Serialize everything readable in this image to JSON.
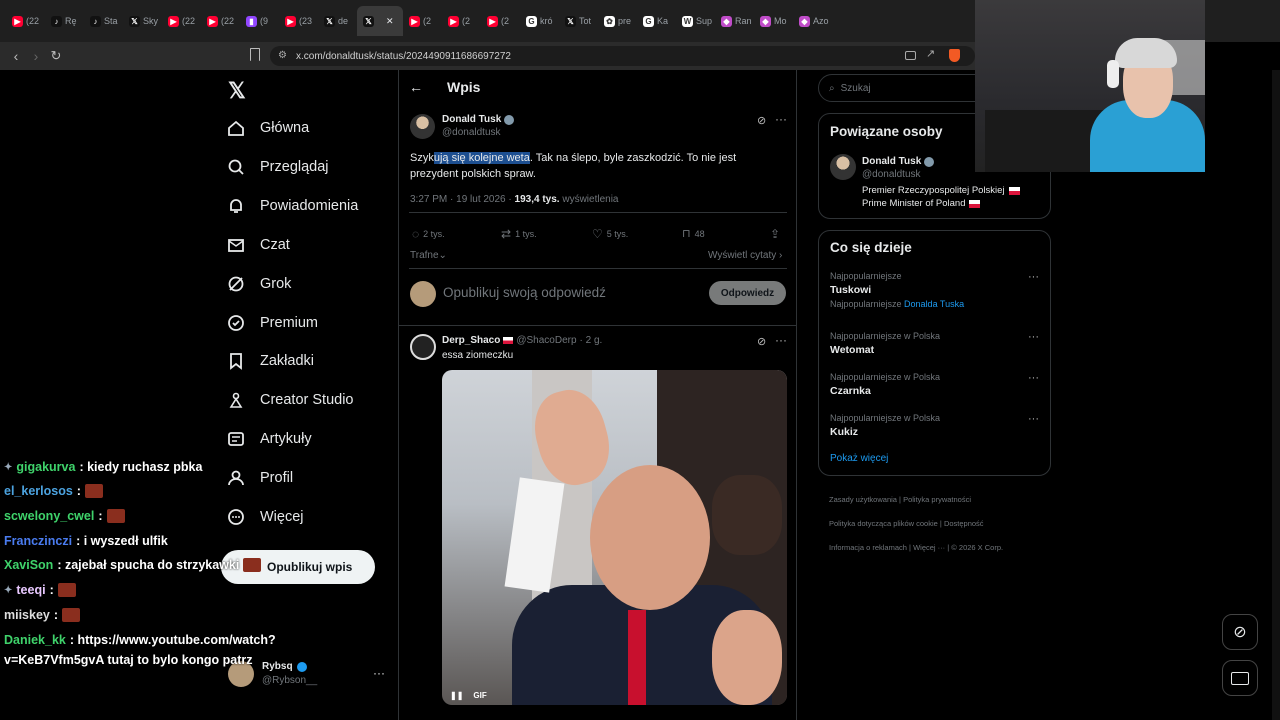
{
  "browser": {
    "tabs": [
      {
        "icon": "youtube-icon",
        "label": "(22"
      },
      {
        "icon": "tiktok-icon",
        "label": "Rę"
      },
      {
        "icon": "tiktok-icon",
        "label": "Sta"
      },
      {
        "icon": "x-icon",
        "label": "Sky"
      },
      {
        "icon": "youtube-icon",
        "label": "(22"
      },
      {
        "icon": "youtube-icon",
        "label": "(22"
      },
      {
        "icon": "twitch-icon",
        "label": "(9"
      },
      {
        "icon": "youtube-icon",
        "label": "(23"
      },
      {
        "icon": "x-icon",
        "label": "de"
      },
      {
        "icon": "x-icon",
        "label": ""
      },
      {
        "icon": "youtube-icon",
        "label": "(2"
      },
      {
        "icon": "youtube-icon",
        "label": "(2"
      },
      {
        "icon": "youtube-icon",
        "label": "(2"
      },
      {
        "icon": "google-icon",
        "label": "kró"
      },
      {
        "icon": "x-icon",
        "label": "Tot"
      },
      {
        "icon": "chatgpt-icon",
        "label": "pre"
      },
      {
        "icon": "google-icon",
        "label": "Ka"
      },
      {
        "icon": "wikipedia-icon",
        "label": "Sup"
      },
      {
        "icon": "app-icon",
        "label": "Ran"
      },
      {
        "icon": "app-icon",
        "label": "Mo"
      },
      {
        "icon": "app-icon",
        "label": "Azo"
      }
    ],
    "url": "x.com/donaldtusk/status/2024490911686697272",
    "colors": {
      "youtube": "#ff0033",
      "accent": "#1d9bf0"
    }
  },
  "nav": {
    "items": [
      {
        "label": "Główna",
        "icon": "home-icon"
      },
      {
        "label": "Przeglądaj",
        "icon": "search-icon"
      },
      {
        "label": "Powiadomienia",
        "icon": "bell-icon"
      },
      {
        "label": "Czat",
        "icon": "mail-icon"
      },
      {
        "label": "Grok",
        "icon": "grok-icon"
      },
      {
        "label": "Premium",
        "icon": "verified-icon"
      },
      {
        "label": "Zakładki",
        "icon": "bookmark-icon"
      },
      {
        "label": "Creator Studio",
        "icon": "creator-icon"
      },
      {
        "label": "Artykuły",
        "icon": "article-icon"
      },
      {
        "label": "Profil",
        "icon": "user-icon"
      },
      {
        "label": "Więcej",
        "icon": "more-icon"
      }
    ],
    "post_button": "Opublikuj wpis",
    "account": {
      "name": "Rybsq",
      "handle": "@Rybson__"
    }
  },
  "chat": [
    {
      "user": "gigakurva",
      "color": "#3fd36b",
      "msg": ": kiedy ruchasz pbka",
      "badge": true
    },
    {
      "user": "el_kerlosos",
      "color": "#4ca3e0",
      "msg": ":",
      "emote": true
    },
    {
      "user": "scwelony_cwel",
      "color": "#3fd36b",
      "msg": ":",
      "emote": true
    },
    {
      "user": "Franczinczi",
      "color": "#4a7cf0",
      "msg": ": i wyszedł ulfik"
    },
    {
      "user": "XaviSon",
      "color": "#3fd36b",
      "msg": ": zajebał spucha do strzykawki",
      "emote": true
    },
    {
      "user": "teeqi",
      "color": "#e8c8ff",
      "msg": ":",
      "emote": true,
      "badge": true
    },
    {
      "user": "miiskey",
      "color": "#dddddd",
      "msg": ":",
      "emote": true
    },
    {
      "user": "Daniek_kk",
      "color": "#3fd36b",
      "msg": ": https://www.youtube.com/watch?"
    },
    {
      "user": "",
      "color": "#ffffff",
      "msg": "v=KeB7Vfm5gvA tutaj to bylo kongo patrz"
    }
  ],
  "post": {
    "header": "Wpis",
    "author": "Donald Tusk",
    "handle": "@donaldtusk",
    "text_selected": "ują się kolejne weta",
    "text_pre": "Szyk",
    "text_post": ". Tak na ślepo, byle zaszkodzić. To nie jest prezydent polskich spraw.",
    "time": "3:27 PM · 19 lut 2026 · ",
    "views_count": "193,4 tys.",
    "views_label": " wyświetlenia",
    "replies": "2 tys.",
    "reposts": "1 tys.",
    "likes": "5 tys.",
    "bookmarks": "48",
    "sort_label": "Trafne",
    "quotes_label": "Wyświetl cytaty",
    "reply_placeholder": "Opublikuj swoją odpowiedź",
    "reply_button": "Odpowiedz"
  },
  "reply": {
    "author": "Derp_Shaco",
    "handle": "@ShacoDerp",
    "age": "· 2 g.",
    "text": "essa ziomeczku",
    "gif_label": "GIF"
  },
  "sidebar": {
    "search_placeholder": "Szukaj",
    "related_title": "Powiązane osoby",
    "related": {
      "name": "Donald Tusk",
      "handle": "@donaldtusk",
      "bio1": "Premier Rzeczypospolitej Polskiej",
      "bio2": "Prime Minister of Poland"
    },
    "trends_title": "Co się dzieje",
    "trends": [
      {
        "context": "Najpopularniejsze",
        "name": "Tuskowi",
        "extra_prefix": "Najpopularniejsze ",
        "extra_link": "Donalda Tuska"
      },
      {
        "context": "Najpopularniejsze w Polska",
        "name": "Wetomat"
      },
      {
        "context": "Najpopularniejsze w Polska",
        "name": "Czarnka"
      },
      {
        "context": "Najpopularniejsze w Polska",
        "name": "Kukiz"
      }
    ],
    "show_more": "Pokaż więcej",
    "footer": [
      [
        "Zasady użytkowania",
        "Polityka prywatności"
      ],
      [
        "Polityka dotycząca plików cookie",
        "Dostępność"
      ],
      [
        "Informacja o reklamach",
        "Więcej ···",
        "© 2026 X Corp."
      ]
    ]
  }
}
